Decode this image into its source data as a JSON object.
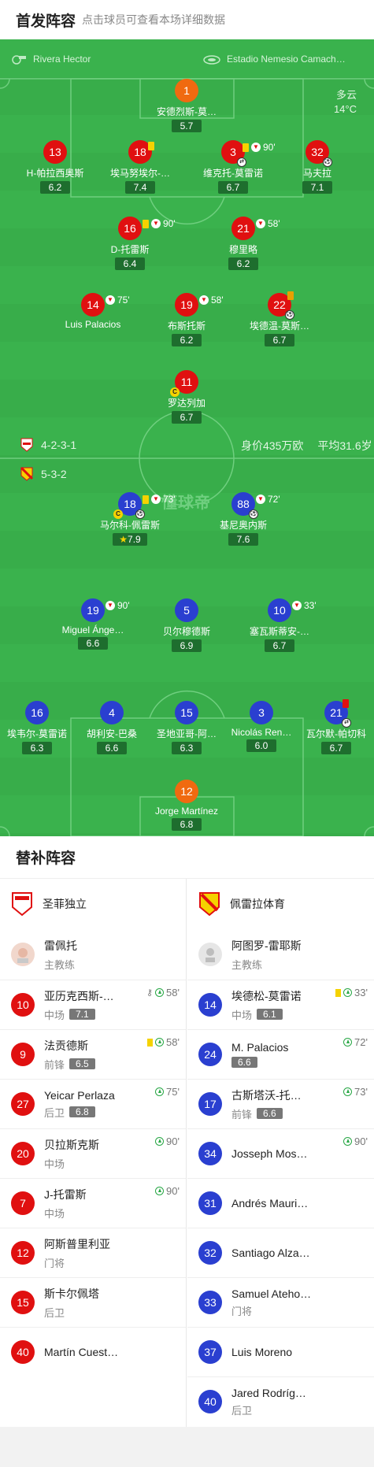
{
  "header": {
    "title": "首发阵容",
    "subtitle": "点击球员可查看本场详细数据"
  },
  "pitch_info": {
    "referee": "Rivera Hector",
    "venue": "Estadio Nemesio Camach…",
    "weather": "多云",
    "temperature": "14°C",
    "home_formation": "4-2-3-1",
    "away_formation": "5-3-2",
    "market_value": "身价435万欧",
    "avg_age": "平均31.6岁",
    "watermark": "懂球帝"
  },
  "home_players": [
    {
      "num": "1",
      "name": "安德烈斯-莫…",
      "rating": "5.7"
    },
    {
      "num": "13",
      "name": "H-帕拉西奥斯",
      "rating": "6.2"
    },
    {
      "num": "18",
      "name": "埃马努埃尔-…",
      "rating": "7.4"
    },
    {
      "num": "3",
      "name": "维克托-莫雷诺",
      "rating": "6.7",
      "minute": "90'"
    },
    {
      "num": "32",
      "name": "马夫拉",
      "rating": "7.1"
    },
    {
      "num": "16",
      "name": "D-托雷斯",
      "rating": "6.4",
      "minute": "90'"
    },
    {
      "num": "21",
      "name": "穆里略",
      "rating": "6.2",
      "minute": "58'"
    },
    {
      "num": "14",
      "name": "Luis Palacios",
      "rating": "",
      "minute": "75'"
    },
    {
      "num": "19",
      "name": "布斯托斯",
      "rating": "6.2",
      "minute": "58'"
    },
    {
      "num": "22",
      "name": "埃德温-莫斯…",
      "rating": "6.7"
    },
    {
      "num": "11",
      "name": "罗达列加",
      "rating": "6.7",
      "captain": "C"
    }
  ],
  "away_players": [
    {
      "num": "18",
      "name": "马尔科-佩雷斯",
      "rating": "7.9",
      "minute": "73'",
      "captain": "C"
    },
    {
      "num": "88",
      "name": "基尼奥内斯",
      "rating": "7.6",
      "minute": "72'"
    },
    {
      "num": "19",
      "name": "Miguel Ánge…",
      "rating": "6.6",
      "minute": "90'"
    },
    {
      "num": "5",
      "name": "贝尔穆德斯",
      "rating": "6.9"
    },
    {
      "num": "10",
      "name": "塞瓦斯蒂安-…",
      "rating": "6.7",
      "minute": "33'"
    },
    {
      "num": "16",
      "name": "埃韦尔-莫雷诺",
      "rating": "6.3"
    },
    {
      "num": "4",
      "name": "胡利安-巴桑",
      "rating": "6.6"
    },
    {
      "num": "15",
      "name": "圣地亚哥-阿…",
      "rating": "6.3"
    },
    {
      "num": "3",
      "name": "Nicolás Ren…",
      "rating": "6.0"
    },
    {
      "num": "21",
      "name": "瓦尔默-帕切科",
      "rating": "6.7"
    },
    {
      "num": "12",
      "name": "Jorge Martínez",
      "rating": "6.8"
    }
  ],
  "subs": {
    "title": "替补阵容",
    "home_team": "圣菲独立",
    "away_team": "佩雷拉体育",
    "home_coach": {
      "name": "雷佩托",
      "role": "主教练"
    },
    "away_coach": {
      "name": "阿图罗-雷耶斯",
      "role": "主教练"
    },
    "home": [
      {
        "num": "10",
        "name": "亚历克西斯-…",
        "pos": "中场",
        "rating": "7.1",
        "minute": "58'"
      },
      {
        "num": "9",
        "name": "法贡德斯",
        "pos": "前锋",
        "rating": "6.5",
        "minute": "58'"
      },
      {
        "num": "27",
        "name": "Yeicar Perlaza",
        "pos": "后卫",
        "rating": "6.8",
        "minute": "75'"
      },
      {
        "num": "20",
        "name": "贝拉斯克斯",
        "pos": "中场",
        "rating": "",
        "minute": "90'"
      },
      {
        "num": "7",
        "name": "J-托雷斯",
        "pos": "中场",
        "rating": "",
        "minute": "90'"
      },
      {
        "num": "12",
        "name": "阿斯普里利亚",
        "pos": "门将",
        "rating": "",
        "minute": ""
      },
      {
        "num": "15",
        "name": "斯卡尔佩塔",
        "pos": "后卫",
        "rating": "",
        "minute": ""
      },
      {
        "num": "40",
        "name": "Martín Cuest…",
        "pos": "",
        "rating": "",
        "minute": ""
      }
    ],
    "away": [
      {
        "num": "14",
        "name": "埃德松-莫雷诺",
        "pos": "中场",
        "rating": "6.1",
        "minute": "33'"
      },
      {
        "num": "24",
        "name": "M. Palacios",
        "pos": "",
        "rating": "6.6",
        "minute": "72'"
      },
      {
        "num": "17",
        "name": "古斯塔沃-托…",
        "pos": "前锋",
        "rating": "6.6",
        "minute": "73'"
      },
      {
        "num": "34",
        "name": "Josseph Mos…",
        "pos": "",
        "rating": "",
        "minute": "90'"
      },
      {
        "num": "31",
        "name": "Andrés Mauri…",
        "pos": "",
        "rating": "",
        "minute": ""
      },
      {
        "num": "32",
        "name": "Santiago Alza…",
        "pos": "",
        "rating": "",
        "minute": ""
      },
      {
        "num": "33",
        "name": "Samuel Ateho…",
        "pos": "门将",
        "rating": "",
        "minute": ""
      },
      {
        "num": "37",
        "name": "Luis Moreno",
        "pos": "",
        "rating": "",
        "minute": ""
      },
      {
        "num": "40",
        "name": "Jared Rodríg…",
        "pos": "后卫",
        "rating": "",
        "minute": ""
      }
    ]
  }
}
